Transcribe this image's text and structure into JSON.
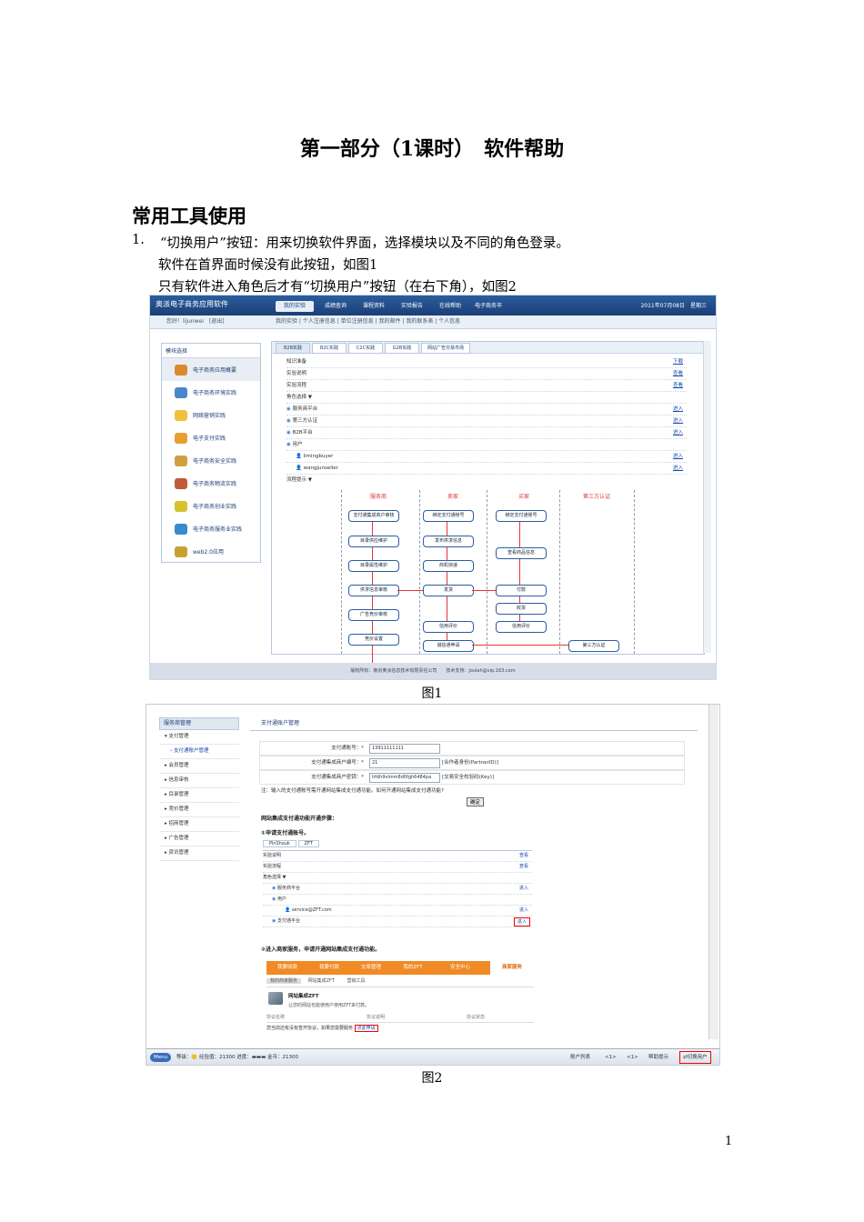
{
  "doc": {
    "title": "第一部分（1课时）　软件帮助",
    "section": "常用工具使用",
    "item_num": "1.",
    "item_text": "“切换用户”按钮：用来切换软件界面，选择模块以及不同的角色登录。",
    "line2": "软件在首界面时候没有此按钮，如图1",
    "line3": "只有软件进入角色后才有“切换用户”按钮（在右下角），如图2",
    "cap1": "图1",
    "cap2": "图2",
    "page_number": "1"
  },
  "fig1": {
    "app_title": "奥派电子商务应用软件",
    "tabs": [
      "我的实验",
      "成绩查询",
      "课程资料",
      "实验报告",
      "在线帮助",
      "电子商务市"
    ],
    "date": "2011年07月08日　星期三",
    "user": "您好！lijunwei　[退出]",
    "subnav": "我的实验 | 个人注册信息 | 单位注册信息 | 我的邮件 | 我的联系表 | 个人信息",
    "side_title": "模块选择",
    "side_items": [
      "电子商务应用概要",
      "电子商务环境实践",
      "网络营销实践",
      "电子支付实践",
      "电子商务安全实践",
      "电子商务物流实践",
      "电子商务创业实践",
      "电子商务服务业实践",
      "web2.0应用"
    ],
    "main_tabs": [
      "B2B实践",
      "B2C实践",
      "C2C实践",
      "G2B实践",
      "网站广告交易市场"
    ],
    "rows": [
      {
        "label": "知识准备",
        "link": "下载"
      },
      {
        "label": "实验说明",
        "link": "查看"
      },
      {
        "label": "实验流程",
        "link": "查看"
      },
      {
        "label": "角色选择 ▼",
        "link": ""
      },
      {
        "label": "服务商平台",
        "link": "进入"
      },
      {
        "label": "第三方认证",
        "link": "进入"
      },
      {
        "label": "B2B平台",
        "link": "进入"
      },
      {
        "label": "用户",
        "link": ""
      },
      {
        "label": "limingbuyer",
        "link": "进入"
      },
      {
        "label": "wangjunseller",
        "link": "进入"
      },
      {
        "label": "流程提示 ▼",
        "link": ""
      }
    ],
    "flow_heads": [
      "服务商",
      "卖家",
      "买家",
      "第三方认证"
    ],
    "flow_boxes": {
      "c1": [
        "支付通集成商户审核",
        "目录供应维护",
        "目录属性维护",
        "供求信息审核",
        "广告竞价审核",
        "竞价设置"
      ],
      "c2": [
        "绑定支付通帐号",
        "发布供求信息",
        "商机快递",
        "发货",
        "信用评价",
        "诚信通申请"
      ],
      "c3": [
        "绑定支付通账号",
        "查看商品信息",
        "付款",
        "收货",
        "信用评价"
      ],
      "c4": [
        "第三方认证"
      ]
    },
    "footer": "版权所有：南京奥派信息技术有限责任公司　　技术支持：joulah@vip.163.com"
  },
  "fig2": {
    "side_head": "服务商管理",
    "side_items": [
      "▾ 支付管理",
      "› 支付通账户管理",
      "▸ 会员管理",
      "▸ 信息审核",
      "▸ 目录管理",
      "▸ 竞价管理",
      "▸ 招商管理",
      "▸ 广告管理",
      "▸ 资讯管理"
    ],
    "main_head": "支付通账户管理",
    "form": [
      {
        "label": "支付通账号：*",
        "value": "13911111111",
        "note": ""
      },
      {
        "label": "支付通集成商户编号：*",
        "value": "21",
        "note": "[合作者身份(PartnerID)]"
      },
      {
        "label": "支付通集成商户密钥：*",
        "value": "hfdh9vlmm8d0fgh6484pa",
        "note": "[交易安全校验码(Key)]"
      }
    ],
    "form_note": "注：输入的支付通账号需开通网站集成支付通功能。如何开通网站集成支付通功能?",
    "confirm": "确定",
    "steps_title": "网站集成支付通功能开通步骤：",
    "step1": "①申请支付通账号。",
    "mini_tabs": [
      "PinShouk",
      "ZFT"
    ],
    "mini_rows": [
      {
        "label": "实验说明",
        "link": "查看"
      },
      {
        "label": "实验流程",
        "link": "查看"
      },
      {
        "label": "角色选择 ▼",
        "link": ""
      },
      {
        "label": "服务商平台",
        "link": "进入"
      },
      {
        "label": "用户",
        "link": ""
      },
      {
        "label": "service@ZFT.com",
        "link": "进入"
      },
      {
        "label": "支付通平台",
        "link": "进入"
      }
    ],
    "step2": "②进入商家服务，申请开通网站集成支付通功能。",
    "orange_tabs": [
      "我要收款",
      "我要付款",
      "交易管理",
      "我的ZFT",
      "安全中心",
      "商家服务"
    ],
    "sub_tabs": [
      "我的商家服务",
      "网站集成ZFT",
      "营销工具"
    ],
    "zft_title": "网站集成ZFT",
    "zft_desc": "让您的网站也能使用户使用ZFT来付款。",
    "tbl_heads": [
      "协议名称",
      "协议说明",
      "协议状态"
    ],
    "tbl_row": "您当前还有没有签开协议，如果您需要服务",
    "apply": "点此申请",
    "status_left": "等级：🙂 经验值：21300 进度：▬▬▬ 金币：21300",
    "status_items": [
      "账户列表",
      "<1>",
      "<1>",
      "帮助提示"
    ],
    "switch_user": "切换用户"
  }
}
